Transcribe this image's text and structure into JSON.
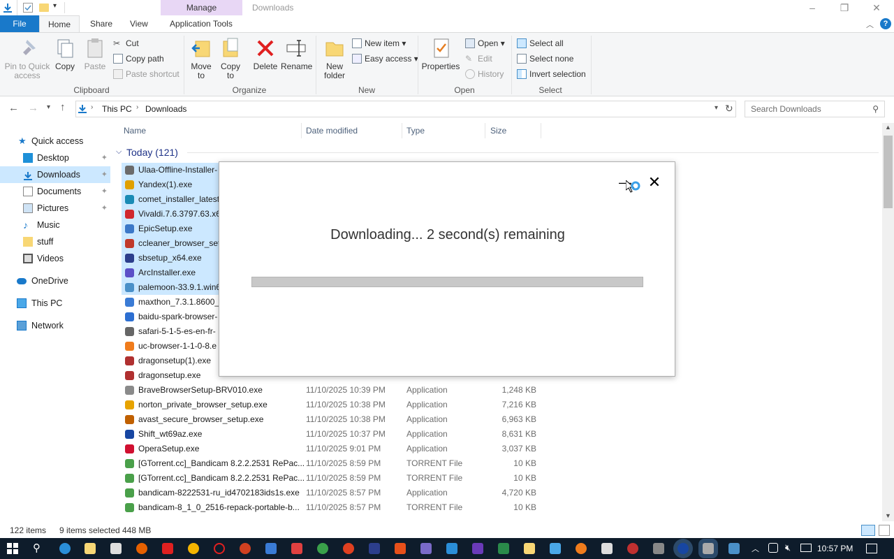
{
  "titlebar": {
    "manage_label": "Manage",
    "window_title": "Downloads",
    "minimize_glyph": "–",
    "restore_glyph": "❐",
    "close_glyph": "✕"
  },
  "ribbon_tabs": {
    "file": "File",
    "home": "Home",
    "share": "Share",
    "view": "View",
    "app_tools": "Application Tools"
  },
  "ribbon": {
    "clipboard": {
      "pin": "Pin to Quick access",
      "copy": "Copy",
      "paste": "Paste",
      "cut": "Cut",
      "copy_path": "Copy path",
      "paste_shortcut": "Paste shortcut",
      "label": "Clipboard"
    },
    "organize": {
      "move_to": "Move to",
      "copy_to": "Copy to",
      "delete": "Delete",
      "rename": "Rename",
      "label": "Organize"
    },
    "new": {
      "new_folder": "New folder",
      "new_item": "New item",
      "easy_access": "Easy access",
      "label": "New"
    },
    "open": {
      "properties": "Properties",
      "open": "Open",
      "edit": "Edit",
      "history": "History",
      "label": "Open"
    },
    "select": {
      "select_all": "Select all",
      "select_none": "Select none",
      "invert": "Invert selection",
      "label": "Select"
    }
  },
  "address": {
    "crumb_1": "This PC",
    "crumb_2": "Downloads",
    "search_placeholder": "Search Downloads"
  },
  "nav": {
    "quick_access": "Quick access",
    "desktop": "Desktop",
    "downloads": "Downloads",
    "documents": "Documents",
    "pictures": "Pictures",
    "music": "Music",
    "stuff": "stuff",
    "videos": "Videos",
    "onedrive": "OneDrive",
    "this_pc": "This PC",
    "network": "Network"
  },
  "columns": {
    "name": "Name",
    "date": "Date modified",
    "type": "Type",
    "size": "Size"
  },
  "group_today": "Today (121)",
  "files": [
    {
      "name": "Ulaa-Offline-Installer-",
      "date": "",
      "type": "",
      "size": "",
      "selected": true,
      "color": "#6b6b6b"
    },
    {
      "name": "Yandex(1).exe",
      "date": "",
      "type": "",
      "size": "",
      "selected": true,
      "color": "#e0a000"
    },
    {
      "name": "comet_installer_latest",
      "date": "",
      "type": "",
      "size": "",
      "selected": true,
      "color": "#1a8bb5"
    },
    {
      "name": "Vivaldi.7.6.3797.63.x64",
      "date": "",
      "type": "",
      "size": "",
      "selected": true,
      "color": "#d0282e"
    },
    {
      "name": "EpicSetup.exe",
      "date": "",
      "type": "",
      "size": "",
      "selected": true,
      "color": "#3c78c8"
    },
    {
      "name": "ccleaner_browser_setu",
      "date": "",
      "type": "",
      "size": "",
      "selected": true,
      "color": "#c0392b"
    },
    {
      "name": "sbsetup_x64.exe",
      "date": "",
      "type": "",
      "size": "",
      "selected": true,
      "color": "#2c3e8c"
    },
    {
      "name": "ArcInstaller.exe",
      "date": "",
      "type": "",
      "size": "",
      "selected": true,
      "color": "#5b4fc7"
    },
    {
      "name": "palemoon-33.9.1.win6",
      "date": "",
      "type": "",
      "size": "",
      "selected": true,
      "color": "#4a90c8"
    },
    {
      "name": "maxthon_7.3.1.8600_x",
      "date": "",
      "type": "",
      "size": "",
      "selected": false,
      "color": "#3a7bd5"
    },
    {
      "name": "baidu-spark-browser-",
      "date": "",
      "type": "",
      "size": "",
      "selected": false,
      "color": "#2d6fd1"
    },
    {
      "name": "safari-5-1-5-es-en-fr-",
      "date": "",
      "type": "",
      "size": "",
      "selected": false,
      "color": "#666666"
    },
    {
      "name": "uc-browser-1-1-0-8.e",
      "date": "",
      "type": "",
      "size": "",
      "selected": false,
      "color": "#f07c1c"
    },
    {
      "name": "dragonsetup(1).exe",
      "date": "",
      "type": "",
      "size": "",
      "selected": false,
      "color": "#b03030"
    },
    {
      "name": "dragonsetup.exe",
      "date": "",
      "type": "",
      "size": "",
      "selected": false,
      "color": "#b03030"
    },
    {
      "name": "BraveBrowserSetup-BRV010.exe",
      "date": "11/10/2025 10:39 PM",
      "type": "Application",
      "size": "1,248 KB",
      "selected": false,
      "color": "#8a8a8a"
    },
    {
      "name": "norton_private_browser_setup.exe",
      "date": "11/10/2025 10:38 PM",
      "type": "Application",
      "size": "7,216 KB",
      "selected": false,
      "color": "#e7a300"
    },
    {
      "name": "avast_secure_browser_setup.exe",
      "date": "11/10/2025 10:38 PM",
      "type": "Application",
      "size": "6,963 KB",
      "selected": false,
      "color": "#c06000"
    },
    {
      "name": "Shift_wt69az.exe",
      "date": "11/10/2025 10:37 PM",
      "type": "Application",
      "size": "8,631 KB",
      "selected": false,
      "color": "#1746a2"
    },
    {
      "name": "OperaSetup.exe",
      "date": "11/10/2025 9:01 PM",
      "type": "Application",
      "size": "3,037 KB",
      "selected": false,
      "color": "#d01030"
    },
    {
      "name": "[GTorrent.cc]_Bandicam 8.2.2.2531 RePac...",
      "date": "11/10/2025 8:59 PM",
      "type": "TORRENT File",
      "size": "10 KB",
      "selected": false,
      "color": "#4aa04a"
    },
    {
      "name": "[GTorrent.cc]_Bandicam 8.2.2.2531 RePac...",
      "date": "11/10/2025 8:59 PM",
      "type": "TORRENT File",
      "size": "10 KB",
      "selected": false,
      "color": "#4aa04a"
    },
    {
      "name": "bandicam-8222531-ru_id4702183ids1s.exe",
      "date": "11/10/2025 8:57 PM",
      "type": "Application",
      "size": "4,720 KB",
      "selected": false,
      "color": "#4aa04a"
    },
    {
      "name": "bandicam-8_1_0_2516-repack-portable-b...",
      "date": "11/10/2025 8:57 PM",
      "type": "TORRENT File",
      "size": "10 KB",
      "selected": false,
      "color": "#4aa04a"
    }
  ],
  "status": {
    "items": "122 items",
    "selected": "9 items selected",
    "size": "448 MB"
  },
  "dialog": {
    "status_text": "Downloading... 2 second(s) remaining",
    "progress": 0.0,
    "close_glyph": "✕",
    "minimize_glyph": "—"
  },
  "taskbar": {
    "time": "10:57 PM"
  }
}
